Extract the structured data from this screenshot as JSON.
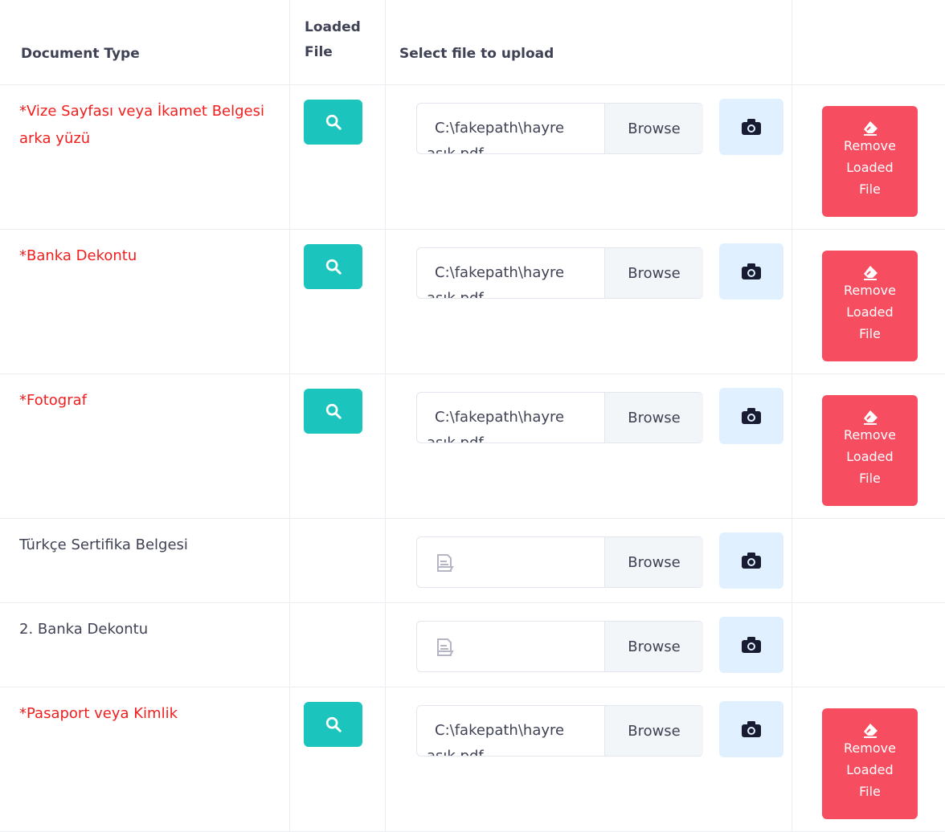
{
  "table": {
    "headers": {
      "document_type": "Document Type",
      "loaded_file": "Loaded\nFile",
      "select_file": "Select file to upload"
    },
    "rows": [
      {
        "label": "*Vize Sayfası veya İkamet Belgesi arka yüzü",
        "required": true,
        "has_file": true,
        "file_line1": "C:\\fakepath\\hayre",
        "file_line2": "aşık.pdf",
        "browse": "Browse",
        "remove_label": "Remove\nLoaded\nFile"
      },
      {
        "label": "*Banka Dekontu",
        "required": true,
        "has_file": true,
        "file_line1": "C:\\fakepath\\hayre",
        "file_line2": "aşık.pdf",
        "browse": "Browse",
        "remove_label": "Remove\nLoaded\nFile"
      },
      {
        "label": "*Fotograf",
        "required": true,
        "has_file": true,
        "file_line1": "C:\\fakepath\\hayre",
        "file_line2": "aşık.pdf",
        "browse": "Browse",
        "remove_label": "Remove\nLoaded\nFile"
      },
      {
        "label": "Türkçe Sertifika Belgesi",
        "required": false,
        "has_file": false,
        "browse": "Browse"
      },
      {
        "label": "2. Banka Dekontu",
        "required": false,
        "has_file": false,
        "browse": "Browse"
      },
      {
        "label": "*Pasaport veya Kimlik",
        "required": true,
        "has_file": true,
        "file_line1": "C:\\fakepath\\hayre",
        "file_line2": "aşık.pdf",
        "browse": "Browse",
        "remove_label": "Remove\nLoaded\nFile"
      }
    ]
  },
  "icons": {
    "view": "search-icon",
    "camera": "camera-icon",
    "remove": "eraser-icon",
    "placeholder": "file-icon"
  },
  "colors": {
    "required_text": "#f21e1e",
    "view_button": "#1bc5bd",
    "remove_button": "#f64e60",
    "camera_button": "#e1f0ff",
    "browse_button": "#f3f6f9"
  }
}
